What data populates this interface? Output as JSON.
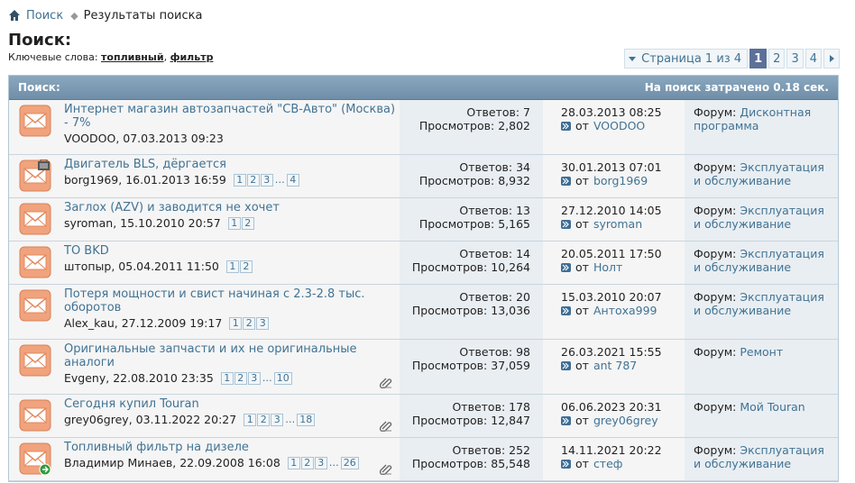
{
  "breadcrumb": {
    "home_link": "Поиск",
    "current": "Результаты поиска"
  },
  "page_title": "Поиск:",
  "keywords": {
    "label": "Ключевые слова:",
    "words": [
      "топливный",
      "фильтр"
    ],
    "separator": ", "
  },
  "pagination": {
    "label": "Страница 1 из 4",
    "pages": [
      "1",
      "2",
      "3",
      "4"
    ],
    "current": "1"
  },
  "table": {
    "header_left": "Поиск:",
    "header_right": "На поиск затрачено 0.18 сек."
  },
  "labels": {
    "replies": "Ответов:",
    "views": "Просмотров:",
    "from": "от",
    "forum": "Форум:"
  },
  "threads": [
    {
      "title": "Интернет магазин автозапчастей \"СВ-Авто\" (Москва) - 7%",
      "author": "VOODOO",
      "date": "07.03.2013 09:23",
      "pages": [],
      "last_page": "",
      "replies": "7",
      "views": "2,802",
      "last_date": "28.03.2013 08:25",
      "last_user": "VOODOO",
      "forum": "Дисконтная программа",
      "icon": "envelope-icon",
      "attachment": false
    },
    {
      "title": "Двигатель BLS, дёргается",
      "author": "borg1969",
      "date": "16.01.2013 16:59",
      "pages": [
        "1",
        "2",
        "3"
      ],
      "last_page": "4",
      "replies": "34",
      "views": "8,932",
      "last_date": "30.01.2013 07:01",
      "last_user": "borg1969",
      "forum": "Эксплуатация и обслуживание",
      "icon": "envelope-locked-icon",
      "attachment": false
    },
    {
      "title": "Заглох (AZV) и заводится не хочет",
      "author": "syroman",
      "date": "15.10.2010 20:57",
      "pages": [
        "1",
        "2"
      ],
      "last_page": "",
      "replies": "13",
      "views": "5,165",
      "last_date": "27.12.2010 14:05",
      "last_user": "syroman",
      "forum": "Эксплуатация и обслуживание",
      "icon": "envelope-icon",
      "attachment": false
    },
    {
      "title": "ТО BKD",
      "author": "штопыр",
      "date": "05.04.2011 11:50",
      "pages": [
        "1",
        "2"
      ],
      "last_page": "",
      "replies": "14",
      "views": "10,264",
      "last_date": "20.05.2011 17:50",
      "last_user": "Нолт",
      "forum": "Эксплуатация и обслуживание",
      "icon": "envelope-icon",
      "attachment": false
    },
    {
      "title": "Потеря мощности и свист начиная с 2.3-2.8 тыс. оборотов",
      "author": "Alex_kau",
      "date": "27.12.2009 19:17",
      "pages": [
        "1",
        "2",
        "3"
      ],
      "last_page": "",
      "replies": "20",
      "views": "13,036",
      "last_date": "15.03.2010 20:07",
      "last_user": "Антоха999",
      "forum": "Эксплуатация и обслуживание",
      "icon": "envelope-icon",
      "attachment": false
    },
    {
      "title": "Оригинальные запчасти и их не оригинальные аналоги",
      "author": "Evgeny",
      "date": "22.08.2010 23:35",
      "pages": [
        "1",
        "2",
        "3"
      ],
      "last_page": "10",
      "replies": "98",
      "views": "37,059",
      "last_date": "26.03.2021 15:55",
      "last_user": "ant 787",
      "forum": "Ремонт",
      "icon": "envelope-icon",
      "attachment": true
    },
    {
      "title": "Сегодня купил Touran",
      "author": "grey06grey",
      "date": "03.11.2022 20:27",
      "pages": [
        "1",
        "2",
        "3"
      ],
      "last_page": "18",
      "replies": "178",
      "views": "12,847",
      "last_date": "06.06.2023 20:31",
      "last_user": "grey06grey",
      "forum": "Мой Touran",
      "icon": "envelope-icon",
      "attachment": true
    },
    {
      "title": "Топливный фильтр на дизеле",
      "author": "Владимир Минаев",
      "date": "22.09.2008 16:08",
      "pages": [
        "1",
        "2",
        "3"
      ],
      "last_page": "26",
      "replies": "252",
      "views": "85,548",
      "last_date": "14.11.2021 20:22",
      "last_user": "стеф",
      "forum": "Эксплуатация и обслуживание",
      "icon": "envelope-moved-icon",
      "attachment": true
    }
  ]
}
